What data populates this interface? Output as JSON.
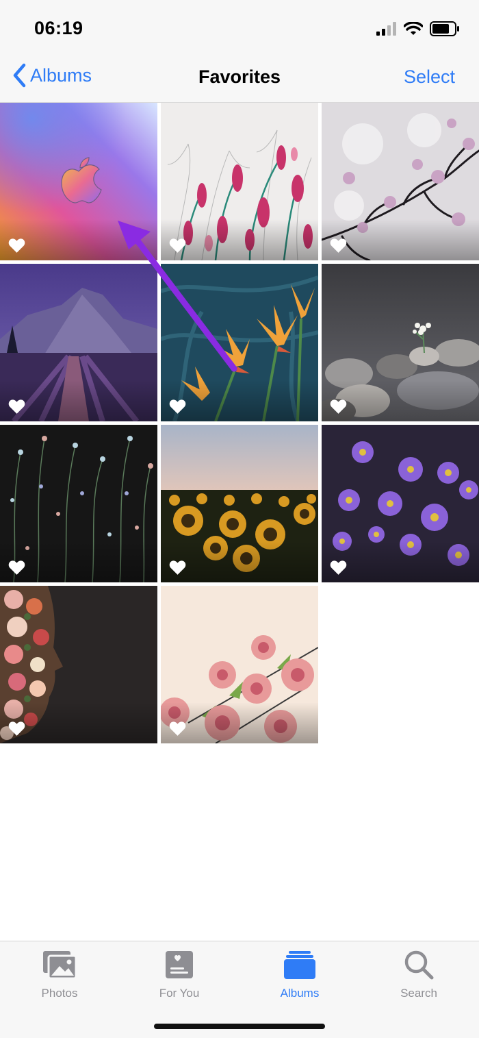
{
  "status_bar": {
    "time": "06:19",
    "icons": [
      "cellular-signal-icon",
      "wifi-icon",
      "battery-icon"
    ]
  },
  "nav": {
    "back_label": "Albums",
    "title": "Favorites",
    "select_label": "Select"
  },
  "photos": [
    {
      "name": "apple-wallpaper",
      "favorite": true
    },
    {
      "name": "flowers-sketch",
      "favorite": true
    },
    {
      "name": "cherry-blossom-branch",
      "favorite": true
    },
    {
      "name": "mountain-lavender-field",
      "favorite": true
    },
    {
      "name": "bird-of-paradise",
      "favorite": true
    },
    {
      "name": "stones-with-flower",
      "favorite": true
    },
    {
      "name": "wildflowers-dark",
      "favorite": true
    },
    {
      "name": "sunflower-field",
      "favorite": true
    },
    {
      "name": "purple-asters",
      "favorite": true
    },
    {
      "name": "floral-profile",
      "favorite": true
    },
    {
      "name": "pink-roses",
      "favorite": true
    }
  ],
  "tabs": [
    {
      "label": "Photos",
      "icon": "photos-icon",
      "active": false
    },
    {
      "label": "For You",
      "icon": "for-you-icon",
      "active": false
    },
    {
      "label": "Albums",
      "icon": "albums-icon",
      "active": true
    },
    {
      "label": "Search",
      "icon": "search-icon",
      "active": false
    }
  ],
  "colors": {
    "accent": "#2f7cf6",
    "inactive_tab": "#8e8e93",
    "annotation_arrow": "#8a2be2"
  }
}
